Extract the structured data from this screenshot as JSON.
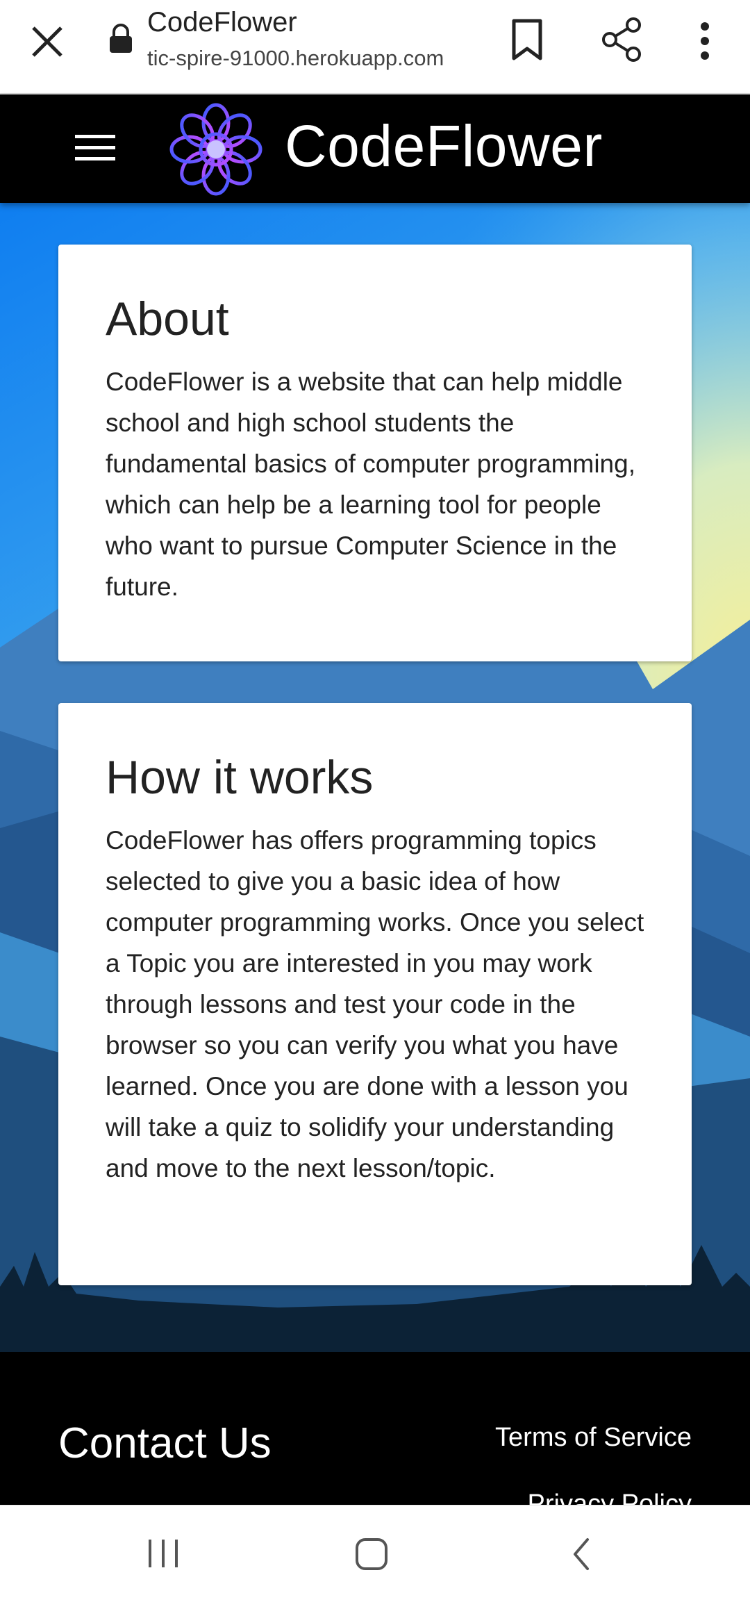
{
  "browser": {
    "page_title": "CodeFlower",
    "url": "tic-spire-91000.herokuapp.com",
    "icons": [
      "close-icon",
      "lock-icon",
      "bookmark-icon",
      "share-icon",
      "more-vert-icon"
    ]
  },
  "header": {
    "site_title": "CodeFlower",
    "menu_icon": "hamburger-menu-icon",
    "logo_icon": "flower-logo-icon"
  },
  "about": {
    "title": "About",
    "body": "CodeFlower is a website that can help middle school and high school students the fundamental basics of computer programming, which can help be a learning tool for people who want to pursue Computer Science in the future."
  },
  "how_it_works": {
    "title": "How it works",
    "body": "CodeFlower has offers programming topics selected to give you a basic idea of how computer programming works. Once you select a Topic you are interested in you may work through lessons and test your code in the browser so you can verify you what you have learned. Once you are done with a lesson you will take a quiz to solidify your understanding and move to the next lesson/topic."
  },
  "footer": {
    "contact_heading": "Contact Us",
    "terms_link": "Terms of Service",
    "privacy_link": "Privacy Policy"
  },
  "system_nav": {
    "icons": [
      "recent-apps-icon",
      "home-icon",
      "back-icon"
    ]
  },
  "colors": {
    "header_bg": "#000000",
    "sky_top": "#1e88f0",
    "sky_glow": "#f4ee9a",
    "logo_gradient": [
      "#3a5bff",
      "#b04bff"
    ]
  }
}
